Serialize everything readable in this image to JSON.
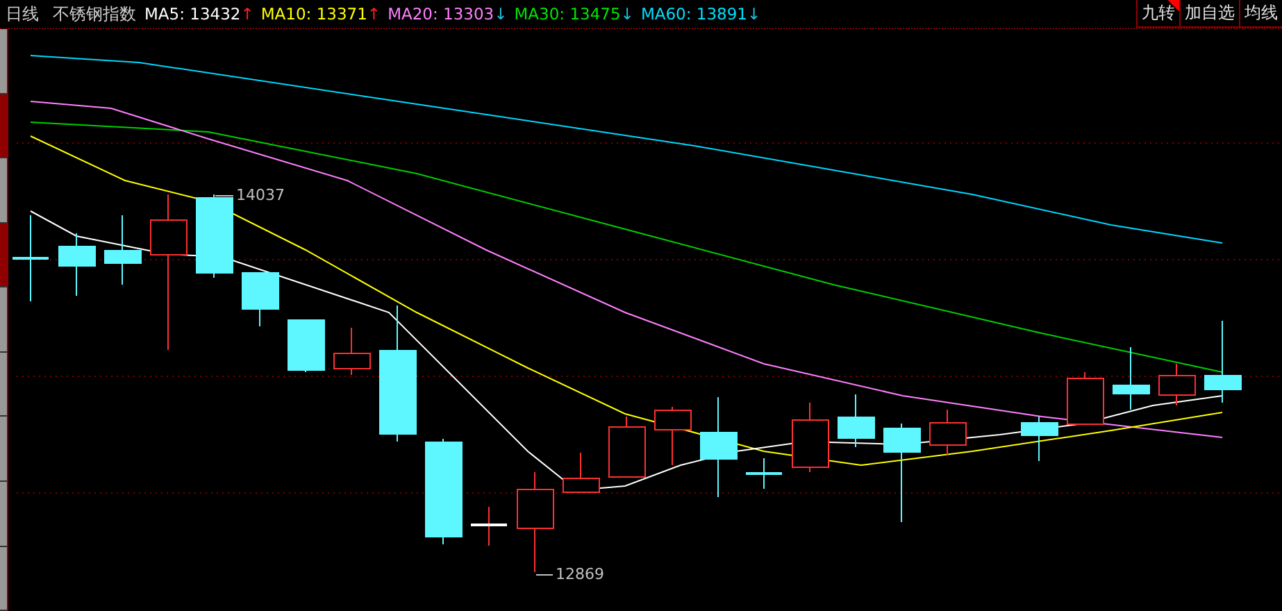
{
  "header": {
    "period": "日线",
    "index_name": "不锈钢指数",
    "legend": [
      {
        "label": "MA5:",
        "value": "13432",
        "color": "#ffffff",
        "arrow": "↑",
        "rising": true
      },
      {
        "label": "MA10:",
        "value": "13371",
        "color": "#ffff00",
        "arrow": "↑",
        "rising": true
      },
      {
        "label": "MA20:",
        "value": "13303",
        "color": "#ff80ff",
        "arrow": "↓",
        "rising": false
      },
      {
        "label": "MA30:",
        "value": "13475",
        "color": "#00e600",
        "arrow": "↓",
        "rising": false
      },
      {
        "label": "MA60:",
        "value": "13891",
        "color": "#00e0ff",
        "arrow": "↓",
        "rising": false
      }
    ],
    "buttons": [
      {
        "label": "九转",
        "flagged": true
      },
      {
        "label": "加自选",
        "flagged": false
      },
      {
        "label": "均线",
        "flagged": false
      }
    ]
  },
  "side_tabs": [
    {
      "selected": false
    },
    {
      "selected": true
    },
    {
      "selected": false
    },
    {
      "selected": true
    },
    {
      "selected": false
    },
    {
      "selected": false
    },
    {
      "selected": false
    },
    {
      "selected": false
    },
    {
      "selected": false
    }
  ],
  "chart": {
    "high_label": "14037",
    "low_label": "12869"
  }
}
